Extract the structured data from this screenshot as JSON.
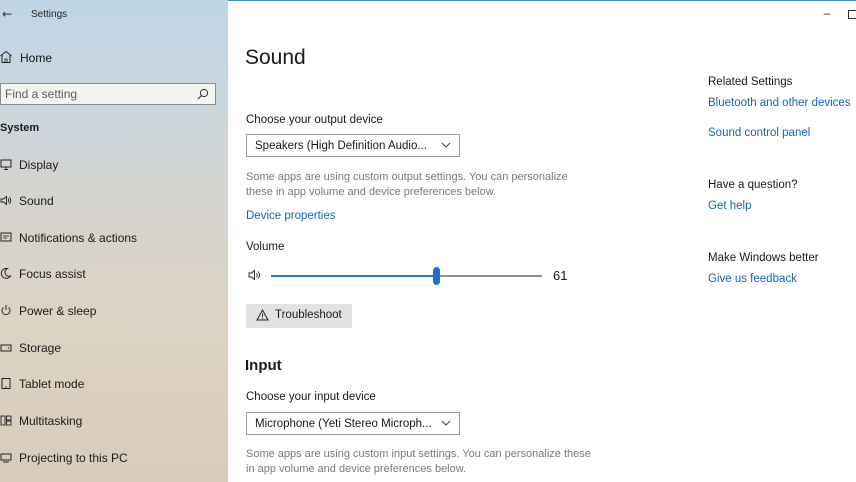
{
  "window": {
    "title": "Settings",
    "minimize_glyph": "–"
  },
  "sidebar": {
    "home_label": "Home",
    "search_placeholder": "Find a setting",
    "section_title": "System",
    "items": [
      {
        "label": "Display",
        "icon": "monitor-icon"
      },
      {
        "label": "Sound",
        "icon": "speaker-icon"
      },
      {
        "label": "Notifications & actions",
        "icon": "notification-icon"
      },
      {
        "label": "Focus assist",
        "icon": "moon-icon"
      },
      {
        "label": "Power & sleep",
        "icon": "power-icon"
      },
      {
        "label": "Storage",
        "icon": "storage-icon"
      },
      {
        "label": "Tablet mode",
        "icon": "tablet-icon"
      },
      {
        "label": "Multitasking",
        "icon": "multitasking-icon"
      },
      {
        "label": "Projecting to this PC",
        "icon": "projector-icon"
      }
    ]
  },
  "main": {
    "title": "Sound",
    "output": {
      "label": "Choose your output device",
      "selected": "Speakers (High Definition Audio...",
      "help": "Some apps are using custom output settings. You can personalize these in app volume and device preferences below.",
      "device_properties_link": "Device properties",
      "volume_label": "Volume",
      "volume_value": "61",
      "volume_level": 61,
      "troubleshoot_label": "Troubleshoot"
    },
    "input": {
      "heading": "Input",
      "label": "Choose your input device",
      "selected": "Microphone (Yeti Stereo Microph...",
      "help": "Some apps are using custom input settings. You can personalize these in app volume and device preferences below."
    }
  },
  "related": {
    "title": "Related Settings",
    "bluetooth_link": "Bluetooth and other devices",
    "sound_panel_link": "Sound control panel",
    "question_title": "Have a question?",
    "get_help_link": "Get help",
    "better_title": "Make Windows better",
    "feedback_link": "Give us feedback"
  },
  "colors": {
    "accent": "#1f6fd1",
    "link": "#1565b8"
  }
}
